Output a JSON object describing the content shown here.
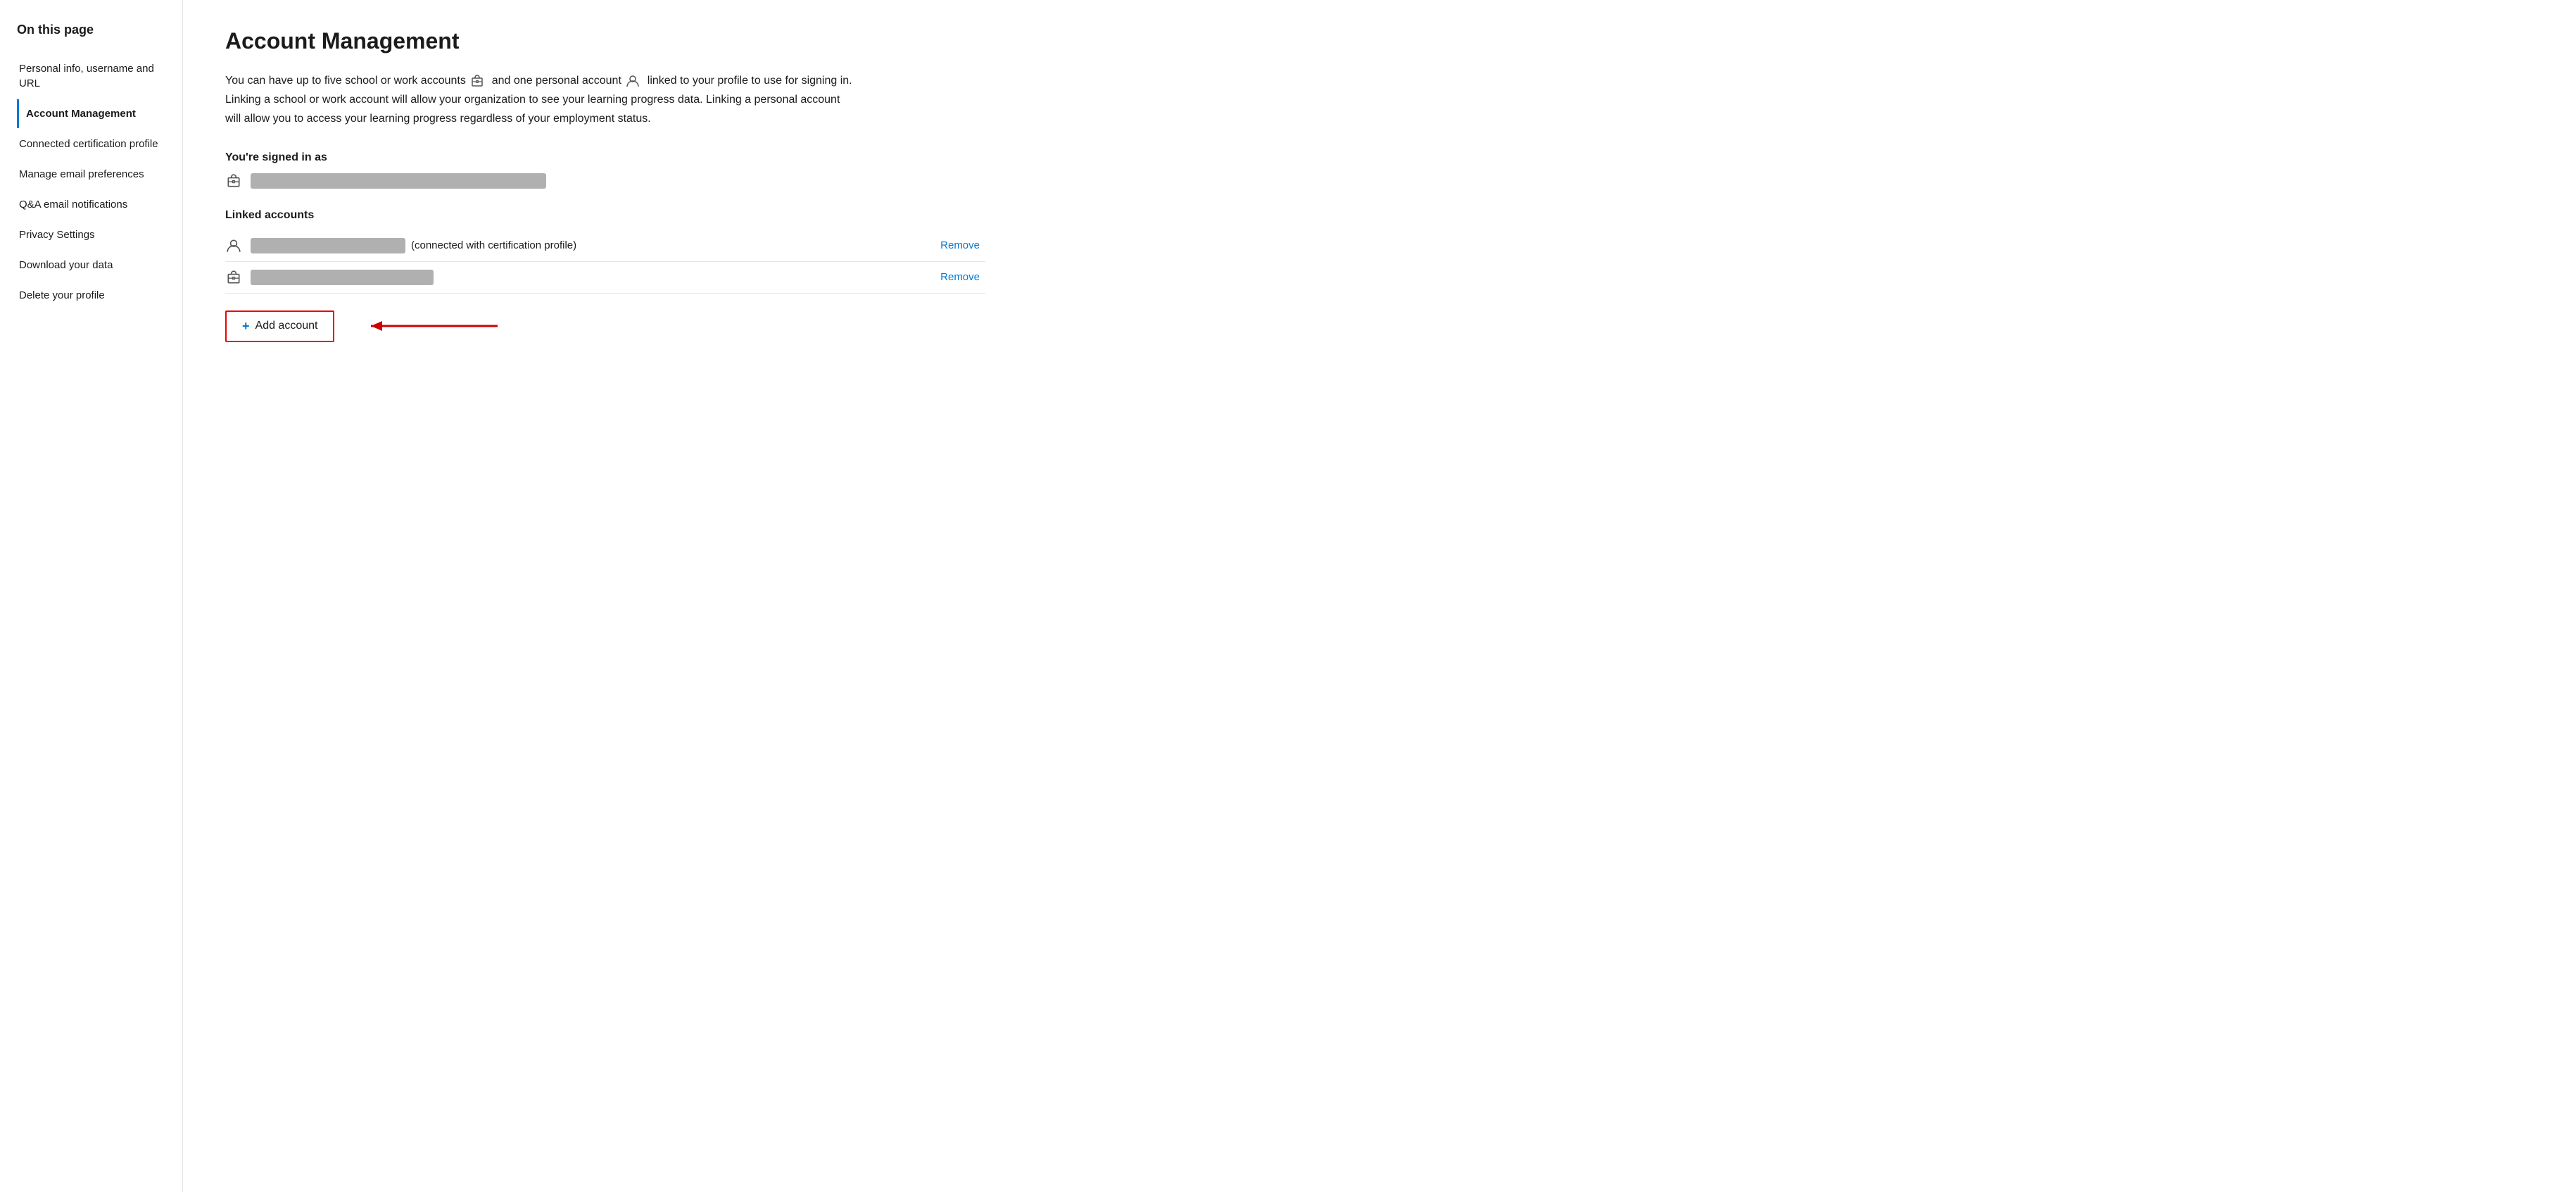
{
  "sidebar": {
    "heading": "On this page",
    "items": [
      {
        "id": "personal-info",
        "label": "Personal info, username and URL",
        "active": false
      },
      {
        "id": "account-management",
        "label": "Account Management",
        "active": true
      },
      {
        "id": "connected-certification",
        "label": "Connected certification profile",
        "active": false
      },
      {
        "id": "manage-email",
        "label": "Manage email preferences",
        "active": false
      },
      {
        "id": "qa-email",
        "label": "Q&A email notifications",
        "active": false
      },
      {
        "id": "privacy-settings",
        "label": "Privacy Settings",
        "active": false
      },
      {
        "id": "download-data",
        "label": "Download your data",
        "active": false
      },
      {
        "id": "delete-profile",
        "label": "Delete your profile",
        "active": false
      }
    ]
  },
  "main": {
    "title": "Account Management",
    "description_part1": "You can have up to five school or work accounts",
    "description_part2": "and one personal account",
    "description_part3": "linked to your profile to use for signing in. Linking a school or work account will allow your organization to see your learning progress data. Linking a personal account will allow you to access your learning progress regardless of your employment status.",
    "signed_in_label": "You're signed in as",
    "linked_accounts_label": "Linked accounts",
    "linked_accounts": [
      {
        "type": "personal",
        "note": "(connected with certification profile)",
        "remove_label": "Remove"
      },
      {
        "type": "work",
        "note": "",
        "remove_label": "Remove"
      }
    ],
    "add_account_label": "Add account",
    "add_account_plus": "+"
  }
}
